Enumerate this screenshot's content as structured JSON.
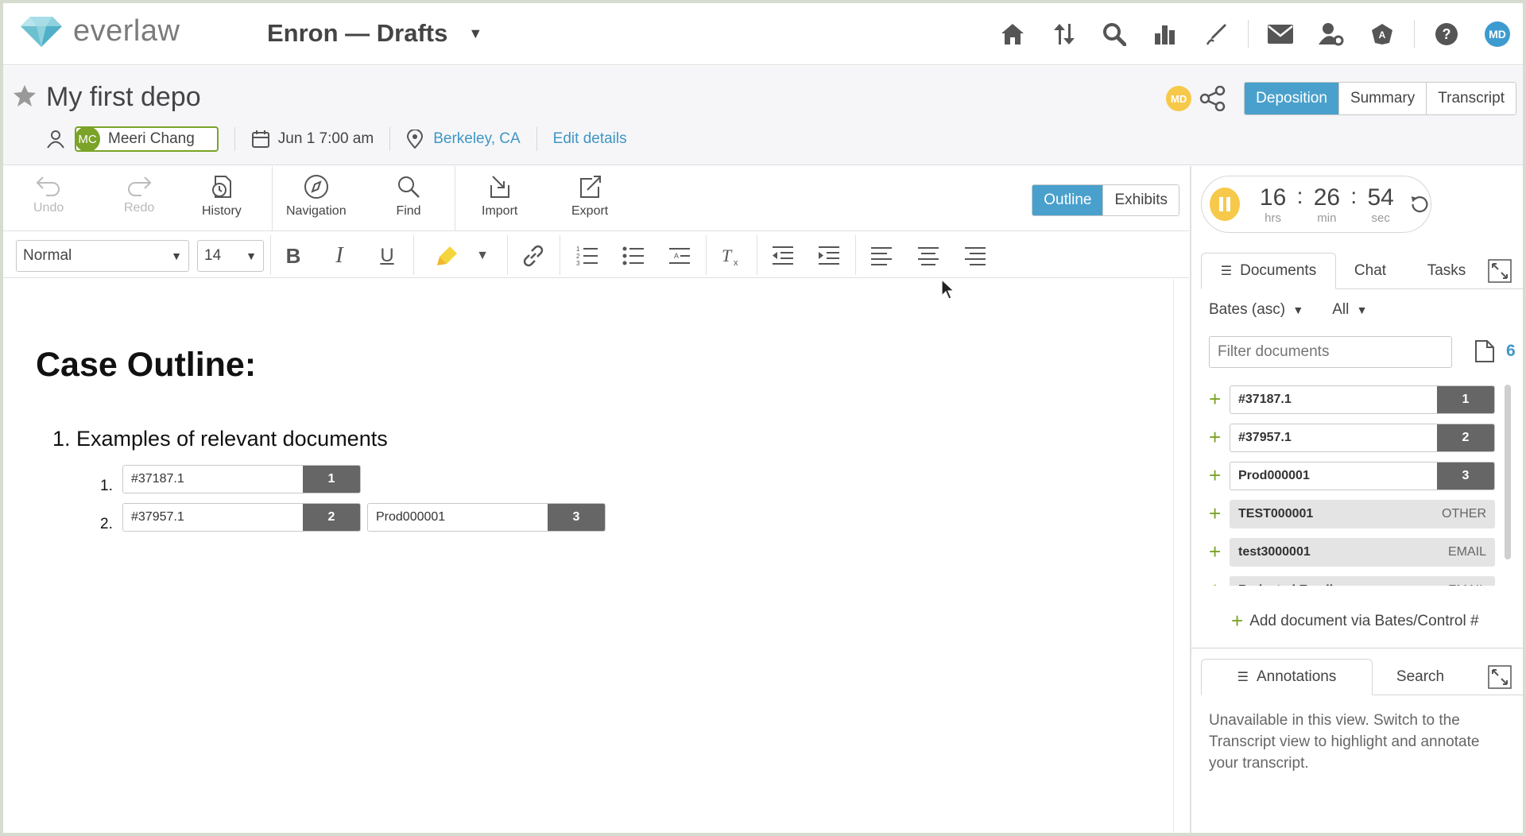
{
  "app": {
    "logo_text": "everlaw",
    "project_title": "Enron — Drafts",
    "user_initials": "MD"
  },
  "depo": {
    "title": "My first depo",
    "witness_initials": "MC",
    "witness_name": "Meeri Chang",
    "datetime": "Jun 1 7:00 am",
    "location": "Berkeley, CA",
    "edit_label": "Edit details",
    "owner_initials": "MD",
    "views": [
      "Deposition",
      "Summary",
      "Transcript"
    ],
    "active_view": "Deposition"
  },
  "toolbar": {
    "undo": "Undo",
    "redo": "Redo",
    "history": "History",
    "navigation": "Navigation",
    "find": "Find",
    "import": "Import",
    "export": "Export",
    "modes": [
      "Outline",
      "Exhibits"
    ],
    "active_mode": "Outline",
    "style_value": "Normal",
    "size_value": "14"
  },
  "document": {
    "heading": "Case Outline:",
    "item1": "1. Examples of relevant documents",
    "sub1_num": "1.",
    "sub2_num": "2.",
    "chips": [
      {
        "name": "#37187.1",
        "num": "1"
      },
      {
        "name": "#37957.1",
        "num": "2"
      },
      {
        "name": "Prod000001",
        "num": "3"
      }
    ]
  },
  "timer": {
    "hrs": "16",
    "min": "26",
    "sec": "54",
    "hrs_label": "hrs",
    "min_label": "min",
    "sec_label": "sec"
  },
  "right_tabs": [
    "Documents",
    "Chat",
    "Tasks"
  ],
  "sort": {
    "label": "Bates (asc)",
    "filter": "All"
  },
  "filter_placeholder": "Filter documents",
  "doc_count": "6",
  "doc_list": [
    {
      "name": "#37187.1",
      "num": "1"
    },
    {
      "name": "#37957.1",
      "num": "2"
    },
    {
      "name": "Prod000001",
      "num": "3"
    },
    {
      "name": "TEST000001",
      "tag": "OTHER"
    },
    {
      "name": "test3000001",
      "tag": "EMAIL"
    },
    {
      "name": "Redacted Email",
      "tag": "EMAIL"
    }
  ],
  "add_doc_label": "Add document via Bates/Control #",
  "bottom_tabs": [
    "Annotations",
    "Search"
  ],
  "unavailable_text": "Unavailable in this view. Switch to the Transcript view to highlight and annotate your transcript.",
  "colors": {
    "accent": "#4aa0cc",
    "green": "#7aa327",
    "yellow": "#f6c94a",
    "chip_dark": "#666666"
  }
}
